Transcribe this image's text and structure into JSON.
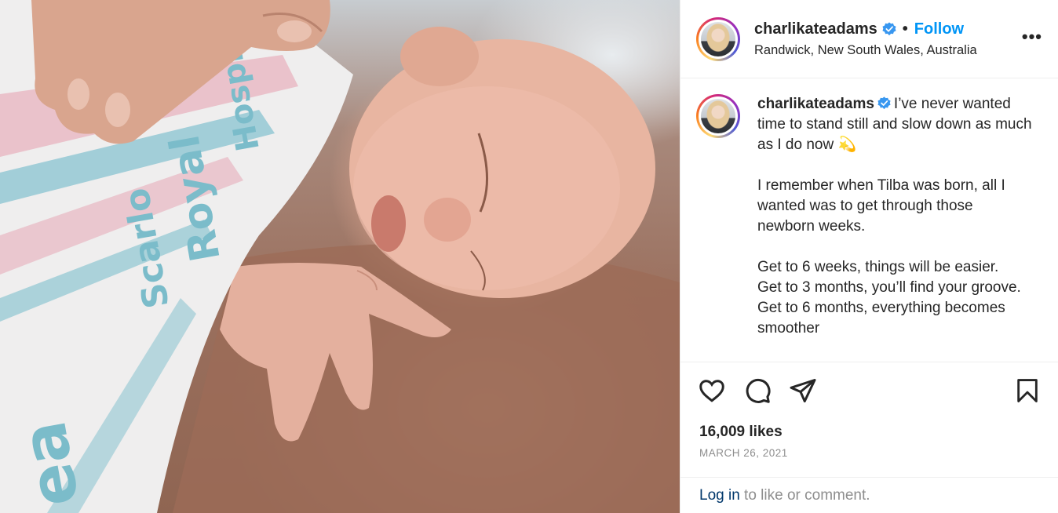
{
  "post": {
    "username": "charlikateadams",
    "follow_label": "Follow",
    "separator": "•",
    "location": "Randwick, New South Wales, Australia",
    "more_label": "•••",
    "caption": "I’ve never wanted time to stand still and slow down as much as I do now 💫\n\nI remember when Tilba was born, all I wanted was to get through those newborn weeks.\n\nGet to 6 weeks, things will be easier.\nGet to 3 months, you’ll find your groove.\nGet to 6 months, everything becomes smoother",
    "likes": "16,009 likes",
    "date": "MARCH 26, 2021",
    "login_link": "Log in",
    "login_rest": " to like or comment."
  },
  "photo": {
    "blanket_text": [
      "Hospital",
      "Scarlo",
      "Royal",
      "ea"
    ]
  },
  "icons": {
    "verified": "verified-badge-icon",
    "like": "heart-icon",
    "comment": "comment-icon",
    "share": "paper-plane-icon",
    "save": "bookmark-icon"
  },
  "colors": {
    "follow_blue": "#0095f6",
    "verified_blue": "#3897f0",
    "link_dark": "#00376b",
    "muted": "#8e8e8e"
  }
}
